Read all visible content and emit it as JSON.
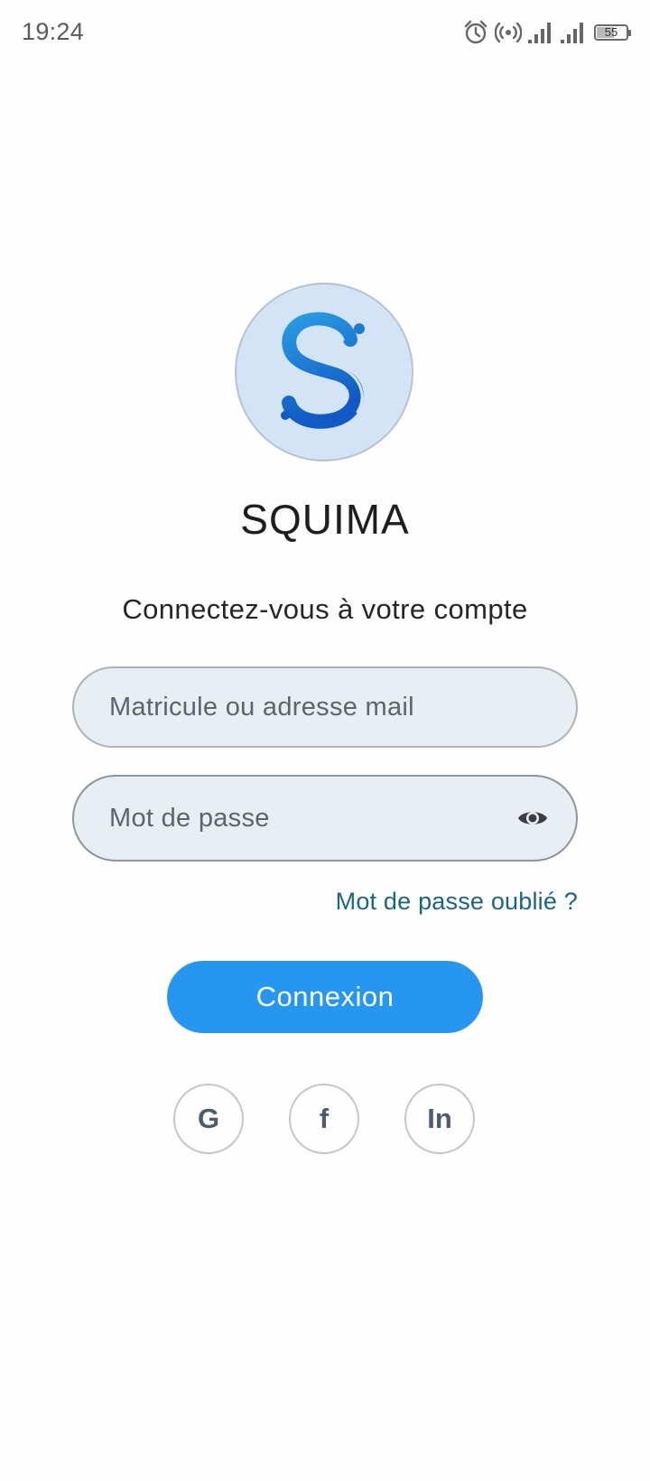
{
  "status_bar": {
    "time": "19:24",
    "battery_level": "55",
    "icons": [
      "alarm-icon",
      "hotspot-icon",
      "signal-icon",
      "signal-icon",
      "battery-icon"
    ]
  },
  "app": {
    "name": "SQUIMA",
    "logo_letter": "S",
    "logo_bg_color": "#d3e4f6",
    "logo_color": "#1d7fd0"
  },
  "login": {
    "subtitle": "Connectez-vous à votre compte",
    "email_placeholder": "Matricule ou adresse mail",
    "email_value": "",
    "password_placeholder": "Mot de passe",
    "password_value": "",
    "forgot_link": "Mot de passe oublié ?",
    "submit_label": "Connexion",
    "accent_color": "#2696f0"
  },
  "social": [
    {
      "label": "G",
      "icon": "google-icon"
    },
    {
      "label": "f",
      "icon": "facebook-icon"
    },
    {
      "label": "In",
      "icon": "linkedin-icon"
    }
  ]
}
